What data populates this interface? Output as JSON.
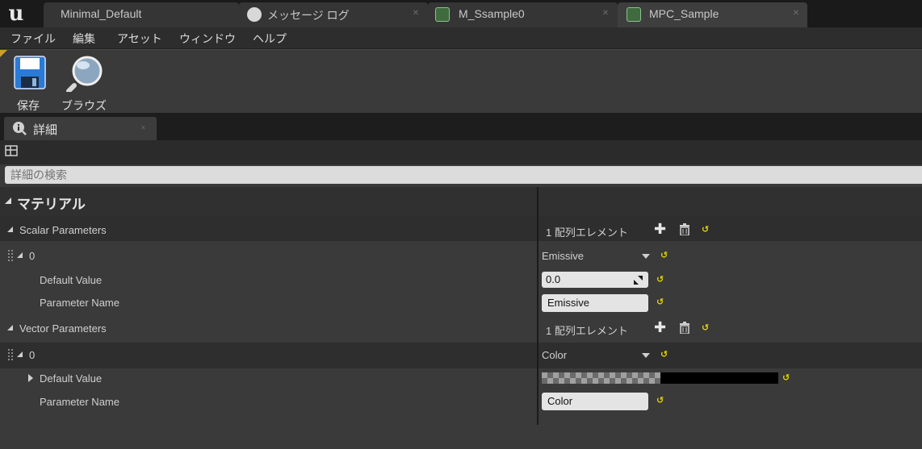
{
  "tabs": [
    {
      "label": "Minimal_Default",
      "active": false
    },
    {
      "label": "メッセージ ログ",
      "active": false
    },
    {
      "label": "M_Ssample0",
      "active": false
    },
    {
      "label": "MPC_Sample",
      "active": true
    }
  ],
  "menu": [
    "ファイル",
    "編集",
    "アセット",
    "ウィンドウ",
    "ヘルプ"
  ],
  "toolbar": {
    "save_label": "保存",
    "browse_label": "ブラウズ"
  },
  "details": {
    "tab_label": "詳細",
    "search_placeholder": "詳細の検索",
    "category": "マテリアル",
    "scalar": {
      "label": "Scalar Parameters",
      "count": "1 配列エレメント",
      "index": "0",
      "dropdown": "Emissive",
      "default_label": "Default Value",
      "default_value": "0.0",
      "name_label": "Parameter Name",
      "name_value": "Emissive"
    },
    "vector": {
      "label": "Vector Parameters",
      "count": "1 配列エレメント",
      "index": "0",
      "dropdown": "Color",
      "default_label": "Default Value",
      "default_color": "#000000",
      "name_label": "Parameter Name",
      "name_value": "Color"
    }
  },
  "colors": {
    "reset": "#e6d400",
    "field": "#e4e4e4",
    "panel": "#3a3a3a"
  }
}
